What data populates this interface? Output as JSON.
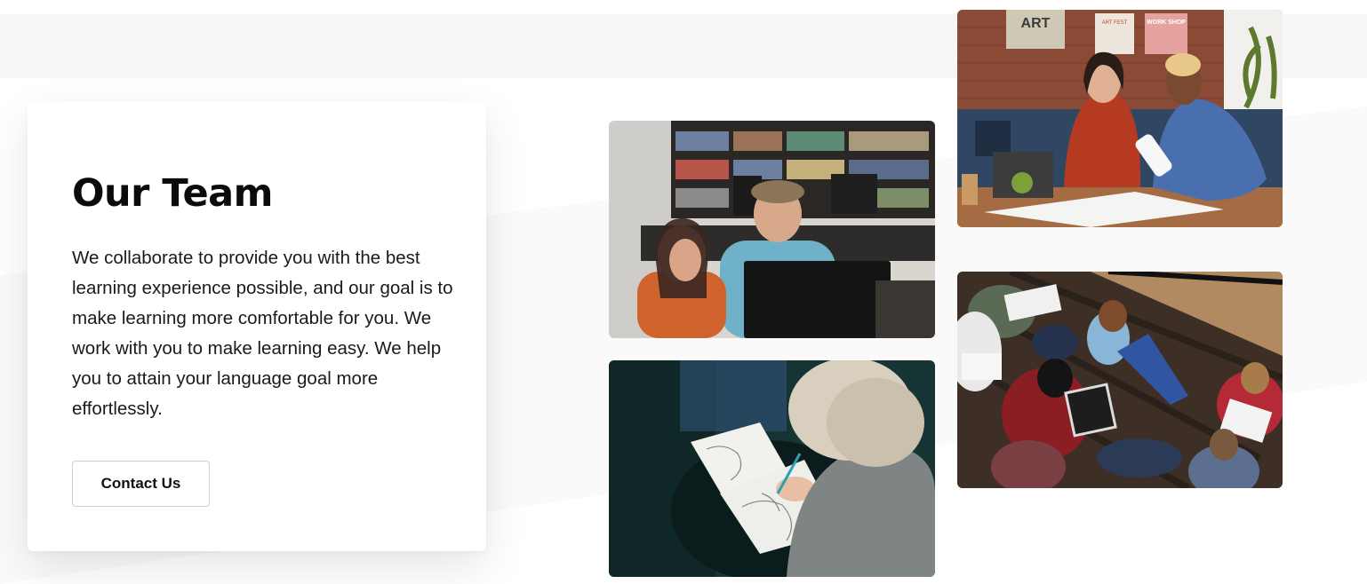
{
  "section": {
    "title": "Our Team",
    "description": "We collaborate to provide you with the best learning experience possible, and our goal is to make learning more comfortable for you. We work with you to make learning easy. We help you to attain your language goal more effortlessly.",
    "contact_button_label": "Contact Us"
  },
  "photos": {
    "art_poster_text": "ART",
    "art_poster_small": "ART FEST",
    "workshop_poster_text": "WORK SHOP"
  },
  "colors": {
    "text_primary": "#0b0b0b",
    "card_bg": "#ffffff",
    "page_bg": "#ffffff",
    "band_bg": "#f7f7f7"
  }
}
